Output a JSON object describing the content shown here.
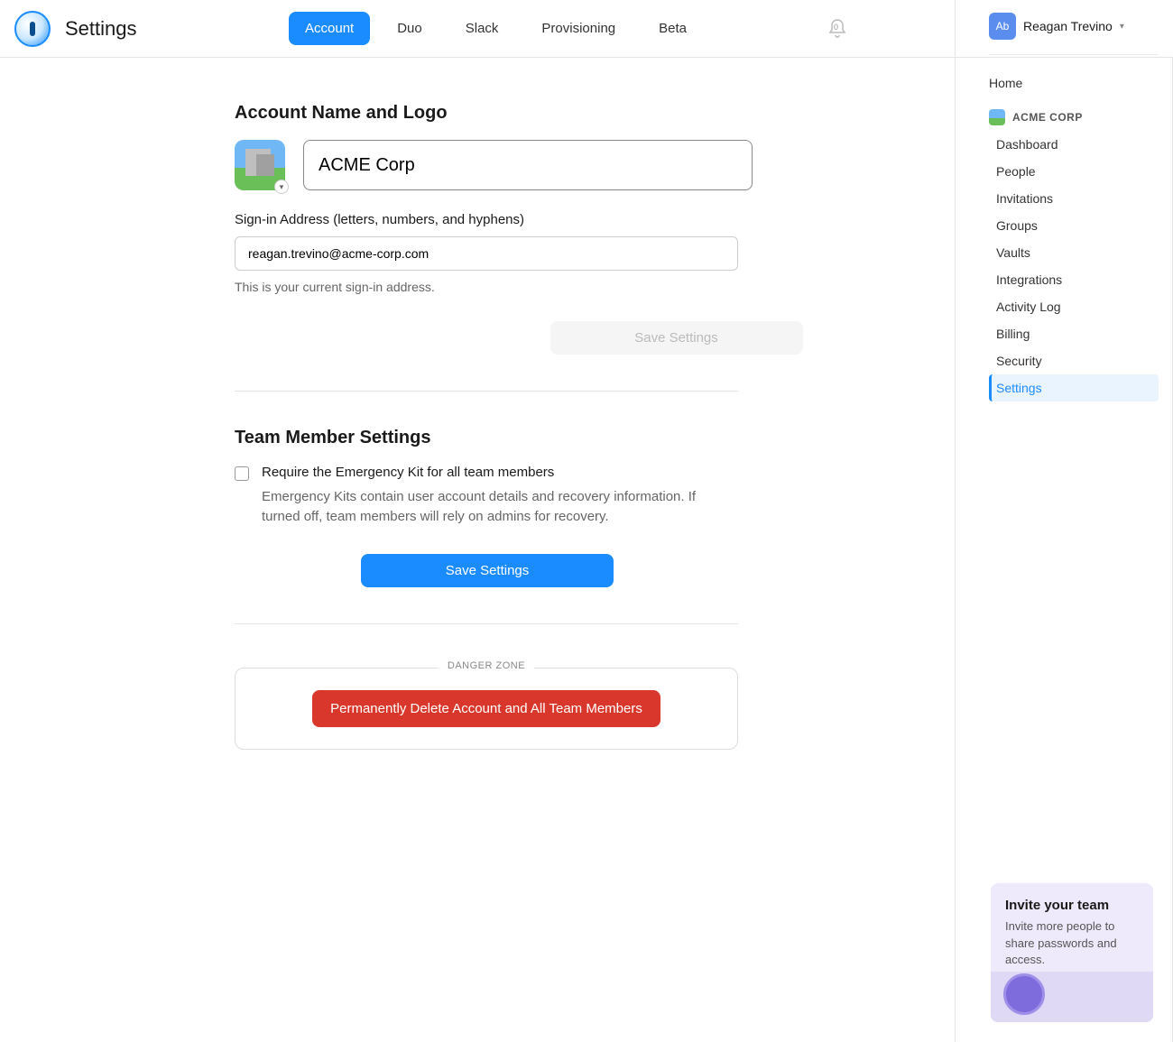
{
  "header": {
    "title": "Settings",
    "tabs": [
      "Account",
      "Duo",
      "Slack",
      "Provisioning",
      "Beta"
    ],
    "active_tab_index": 0,
    "notification_count": "0"
  },
  "account_section": {
    "heading": "Account Name and Logo",
    "account_name_value": "ACME Corp",
    "signin_label": "Sign-in Address (letters, numbers, and hyphens)",
    "signin_value": "reagan.trevino@acme-corp.com",
    "signin_hint": "This is your current sign-in address.",
    "save_disabled_label": "Save Settings"
  },
  "team_section": {
    "heading": "Team Member Settings",
    "checkbox_label": "Require the Emergency Kit for all team members",
    "checkbox_desc": "Emergency Kits contain user account details and recovery information. If turned off, team members will rely on admins for recovery.",
    "save_label": "Save Settings"
  },
  "danger": {
    "zone_label": "DANGER ZONE",
    "delete_label": "Permanently Delete Account and All Team Members"
  },
  "user": {
    "avatar_initials": "Ab",
    "name": "Reagan Trevino"
  },
  "sidebar": {
    "home": "Home",
    "org_name": "ACME CORP",
    "links": [
      "Dashboard",
      "People",
      "Invitations",
      "Groups",
      "Vaults",
      "Integrations",
      "Activity Log",
      "Billing",
      "Security",
      "Settings"
    ],
    "active_link_index": 9
  },
  "invite_card": {
    "title": "Invite your team",
    "desc": "Invite more people to share passwords and access."
  }
}
